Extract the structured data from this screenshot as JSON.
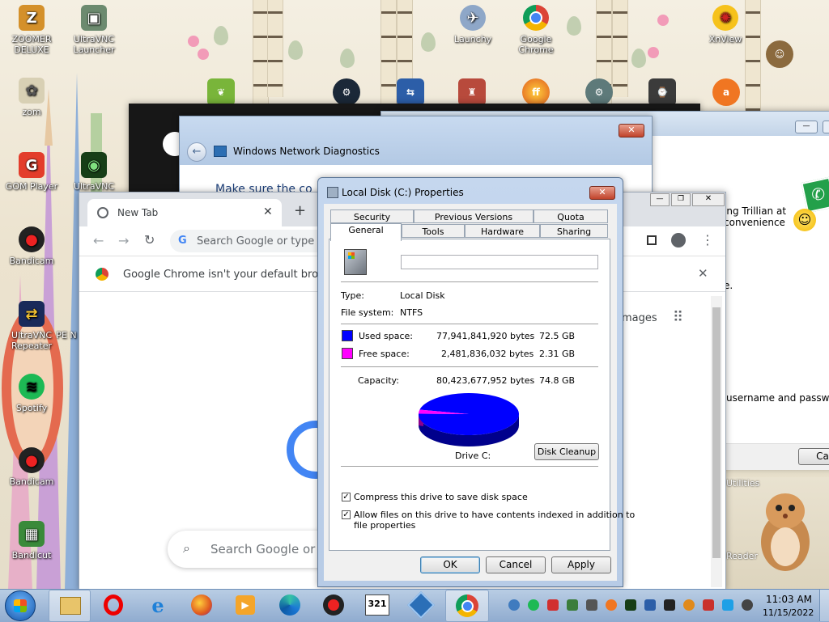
{
  "desktop": {
    "icons": [
      {
        "label": "ZOOMER DELUXE"
      },
      {
        "label": "UltraVNC Launcher"
      },
      {
        "label": "zom"
      },
      {
        "label": "GOM Player"
      },
      {
        "label": "UltraVNC"
      },
      {
        "label": "Bandicam"
      },
      {
        "label": "UltraVNC Repeater"
      },
      {
        "label": "PE N"
      },
      {
        "label": "Spotify"
      },
      {
        "label": "Bandicam"
      },
      {
        "label": "Bandicut"
      },
      {
        "label": "Launchy"
      },
      {
        "label": "Google Chrome"
      },
      {
        "label": "XnView"
      }
    ],
    "partial_right": {
      "line1": "ing Trillian at",
      "line2": "convenience",
      "line3": "e.",
      "line4": "username and password",
      "utilities": "Utilities",
      "reader": "Reader"
    }
  },
  "network_diag": {
    "title": "Windows Network Diagnostics",
    "body_text": "Make sure the co"
  },
  "chrome": {
    "tab_title": "New Tab",
    "omnibox_placeholder": "Search Google or type a",
    "infobar_text": "Google Chrome isn't your default browser",
    "images_link": "mages",
    "search_placeholder": "Search Google or t"
  },
  "properties": {
    "title": "Local Disk (C:) Properties",
    "tabs_row1": [
      "Security",
      "Previous Versions",
      "Quota"
    ],
    "tabs_row2": [
      "General",
      "Tools",
      "Hardware",
      "Sharing"
    ],
    "active_tab": "General",
    "volume_label_value": "",
    "type_label": "Type:",
    "type_value": "Local Disk",
    "fs_label": "File system:",
    "fs_value": "NTFS",
    "used_label": "Used space:",
    "used_bytes": "77,941,841,920 bytes",
    "used_gb": "72.5 GB",
    "free_label": "Free space:",
    "free_bytes": "2,481,836,032 bytes",
    "free_gb": "2.31 GB",
    "capacity_label": "Capacity:",
    "capacity_bytes": "80,423,677,952 bytes",
    "capacity_gb": "74.8 GB",
    "drive_label": "Drive C:",
    "disk_cleanup": "Disk Cleanup",
    "compress_label": "Compress this drive to save disk space",
    "index_label_1": "Allow files on this drive to have contents indexed in addition to",
    "index_label_2": "file properties",
    "ok": "OK",
    "cancel": "Cancel",
    "apply": "Apply",
    "used_fraction": 0.969,
    "colors": {
      "used": "#0000ff",
      "free": "#ff00ff"
    }
  },
  "taskbar": {
    "clock_time": "11:03 AM",
    "clock_date": "11/15/2022",
    "pinned": [
      "start-orb",
      "file-explorer",
      "opera",
      "internet-explorer",
      "firefox",
      "media-player",
      "edge",
      "bandicam",
      "321-player",
      "virtualbox",
      "chrome"
    ]
  },
  "partial_window_right": {
    "cancel_partial": "Ca"
  }
}
